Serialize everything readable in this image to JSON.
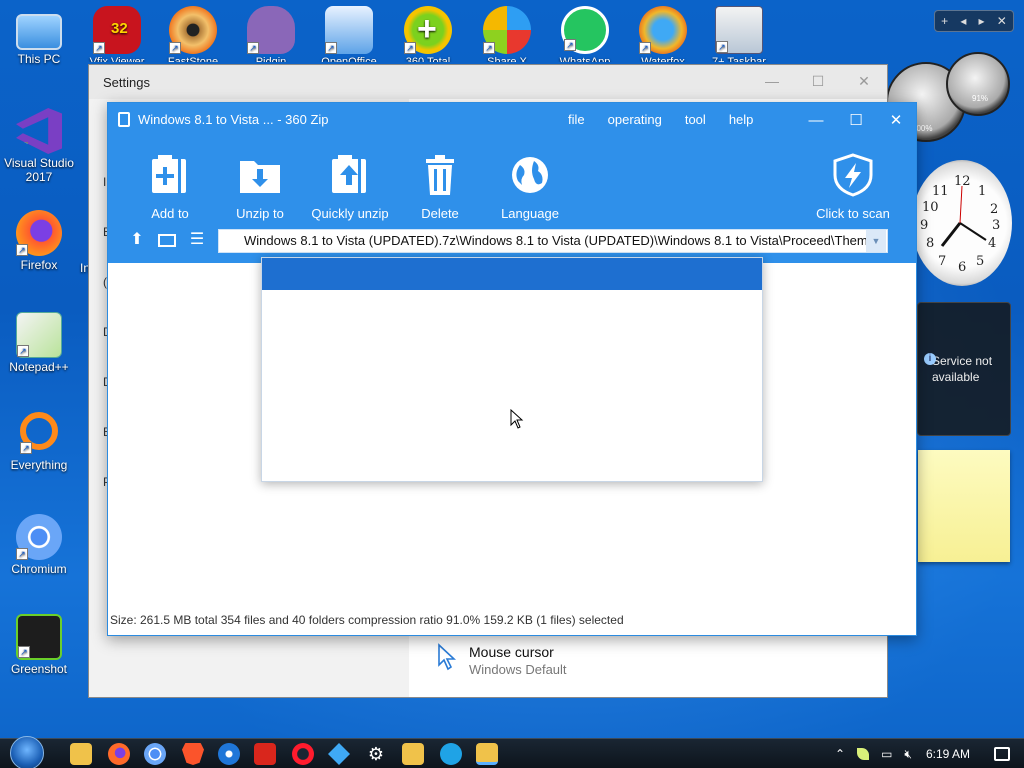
{
  "desktop": {
    "left_icons": [
      {
        "label": "This PC"
      },
      {
        "label": "Visual Studio 2017"
      },
      {
        "label": "Firefox"
      },
      {
        "label": "Notepad++"
      },
      {
        "label": "Everything"
      },
      {
        "label": "Chromium"
      },
      {
        "label": "Greenshot"
      }
    ],
    "top_icons": [
      {
        "label": "Vfix Viewer"
      },
      {
        "label": "FastStone"
      },
      {
        "label": "Pidgin"
      },
      {
        "label": "OpenOffice"
      },
      {
        "label": "360 Total"
      },
      {
        "label": "Share X"
      },
      {
        "label": "WhatsApp"
      },
      {
        "label": "Waterfox"
      },
      {
        "label": "7+ Taskbar"
      }
    ],
    "badge_32": "32",
    "stray_label": "In"
  },
  "gadgets": {
    "toolbar": [
      "+",
      "◂",
      "▸",
      "✕"
    ],
    "meter_readouts": [
      "100%",
      "91%"
    ],
    "clock_numbers": [
      "12",
      "1",
      "2",
      "3",
      "4",
      "5",
      "6",
      "7",
      "8",
      "9",
      "10",
      "11"
    ],
    "weather_text": "Service not available"
  },
  "settings": {
    "title": "Settings",
    "controls": [
      "—",
      "☐",
      "✕"
    ],
    "sidebar_letters": [
      "I",
      "E",
      "(",
      "D",
      "D",
      "E",
      "P"
    ],
    "mouse_cursor_title": "Mouse cursor",
    "mouse_cursor_value": "Windows Default"
  },
  "zip": {
    "title": "Windows 8.1 to Vista ... - 360 Zip",
    "menu": [
      "file",
      "operating",
      "tool",
      "help"
    ],
    "controls": [
      "—",
      "☐",
      "✕"
    ],
    "tools": [
      {
        "label": "Add to"
      },
      {
        "label": "Unzip to"
      },
      {
        "label": "Quickly unzip"
      },
      {
        "label": "Delete"
      },
      {
        "label": "Language"
      }
    ],
    "scan_label": "Click to scan",
    "path": "Windows 8.1 to Vista (UPDATED).7z\\Windows 8.1 to Vista (UPDATED)\\Windows 8.1 to Vista\\Proceed\\Them",
    "status": "Size: 261.5 MB total 354 files and 40 folders compression ratio 91.0% 159.2 KB (1 files) selected"
  },
  "taskbar": {
    "time": "6:19 AM",
    "tray_icons": [
      "chevron-up",
      "leaf",
      "network",
      "volume-mute",
      "notifications"
    ]
  },
  "colors": {
    "zip_blue": "#2f90ea",
    "dialog_bar": "#1e6fd0",
    "desktop_blue": "#0b63c9"
  }
}
